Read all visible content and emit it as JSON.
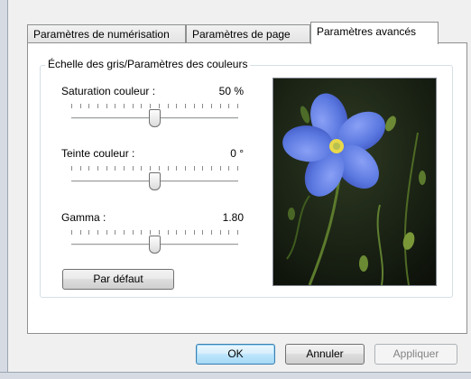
{
  "tabs": [
    {
      "label": "Paramètres de numérisation",
      "active": false
    },
    {
      "label": "Paramètres de page",
      "active": false
    },
    {
      "label": "Paramètres avancés",
      "active": true
    }
  ],
  "group": {
    "legend": "Échelle des gris/Paramètres des couleurs"
  },
  "sliders": [
    {
      "label": "Saturation couleur :",
      "value_text": "50 %",
      "level": 0.5,
      "ticks": 20
    },
    {
      "label": "Teinte couleur :",
      "value_text": "0 °",
      "level": 0.5,
      "ticks": 20
    },
    {
      "label": "Gamma :",
      "value_text": "1.80",
      "level": 0.5,
      "ticks": 20
    }
  ],
  "defaults_button": "Par défaut",
  "preview": {
    "icon": "flower-preview-image"
  },
  "footer": {
    "ok": "OK",
    "cancel": "Annuler",
    "apply": "Appliquer"
  },
  "colors": {
    "accent": "#3c7fb1",
    "petal": "#5a78e0",
    "flower_center": "#e8d84a"
  }
}
